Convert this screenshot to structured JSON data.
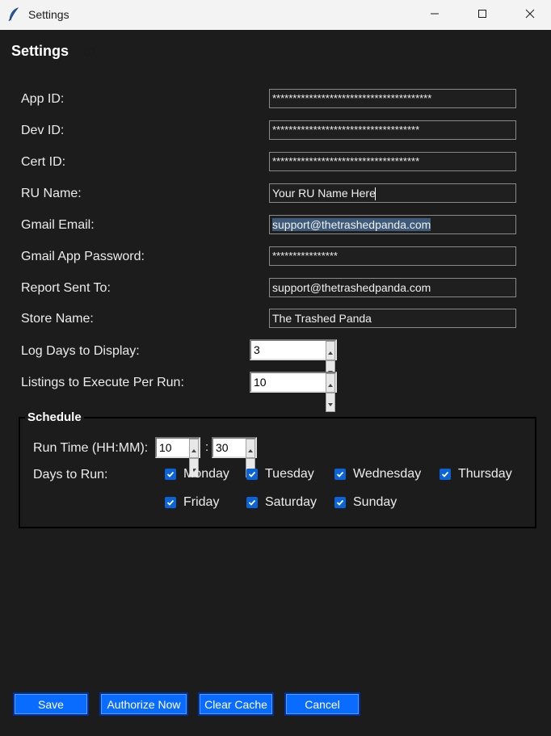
{
  "window": {
    "title": "Settings"
  },
  "dialog": {
    "title": "Settings",
    "info_icon": "info-icon"
  },
  "fields": [
    {
      "label": "App ID:",
      "value": "***************************************",
      "masked": true
    },
    {
      "label": "Dev ID:",
      "value": "************************************",
      "masked": true
    },
    {
      "label": "Cert ID:",
      "value": "************************************",
      "masked": true
    },
    {
      "label": "RU Name:",
      "value": "Your RU Name Here",
      "masked": false
    },
    {
      "label": "Gmail Email:",
      "value": "support@thetrashedpanda.com",
      "masked": false
    },
    {
      "label": "Gmail App Password:",
      "value": "****************",
      "masked": true
    },
    {
      "label": "Report Sent To:",
      "value": "support@thetrashedpanda.com",
      "masked": false
    },
    {
      "label": "Store Name:",
      "value": "The Trashed Panda",
      "masked": false
    }
  ],
  "log_days": {
    "label": "Log Days to Display:",
    "value": "3"
  },
  "listings_per_run": {
    "label": "Listings to Execute Per Run:",
    "value": "10"
  },
  "schedule": {
    "title": "Schedule",
    "run_time_label": "Run Time (HH:MM):",
    "hour": "10",
    "separator": ":",
    "minute": "30",
    "days_label": "Days to Run:",
    "days": [
      {
        "label": "Monday",
        "checked": true
      },
      {
        "label": "Tuesday",
        "checked": true
      },
      {
        "label": "Wednesday",
        "checked": true
      },
      {
        "label": "Thursday",
        "checked": true
      },
      {
        "label": "Friday",
        "checked": true
      },
      {
        "label": "Saturday",
        "checked": true
      },
      {
        "label": "Sunday",
        "checked": true
      }
    ]
  },
  "buttons": {
    "save": "Save",
    "authorize": "Authorize Now",
    "clear_cache": "Clear Cache",
    "cancel": "Cancel"
  },
  "colors": {
    "background": "#1c1c1c",
    "button": "#0a6cff",
    "checkbox": "#0a64d8"
  }
}
